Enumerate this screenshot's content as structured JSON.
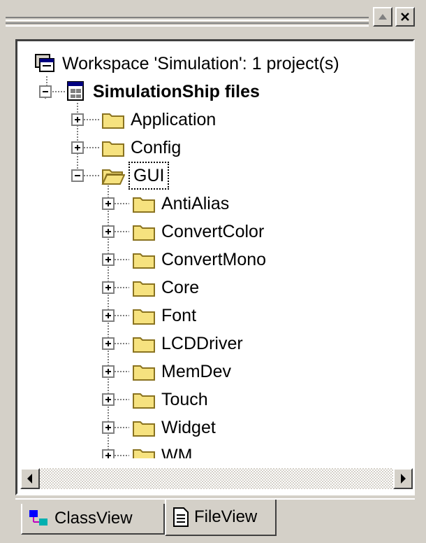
{
  "window": {
    "scroll_up_label": "▲",
    "close_label": "✕"
  },
  "tree": {
    "workspace": "Workspace 'Simulation': 1 project(s)",
    "project": "SimulationShip files",
    "folders": [
      {
        "label": "Application",
        "expanded": false
      },
      {
        "label": "Config",
        "expanded": false
      },
      {
        "label": "GUI",
        "expanded": true,
        "selected": true
      }
    ],
    "gui_children": [
      "AntiAlias",
      "ConvertColor",
      "ConvertMono",
      "Core",
      "Font",
      "LCDDriver",
      "MemDev",
      "Touch",
      "Widget",
      "WM"
    ]
  },
  "tabs": [
    {
      "label": "ClassView",
      "icon": "class-view-icon",
      "active": false
    },
    {
      "label": "FileView",
      "icon": "file-view-icon",
      "active": true
    }
  ],
  "colors": {
    "chrome": "#d4d0c8",
    "folder": "#f6e27f",
    "folder_dark": "#c2a23a"
  }
}
